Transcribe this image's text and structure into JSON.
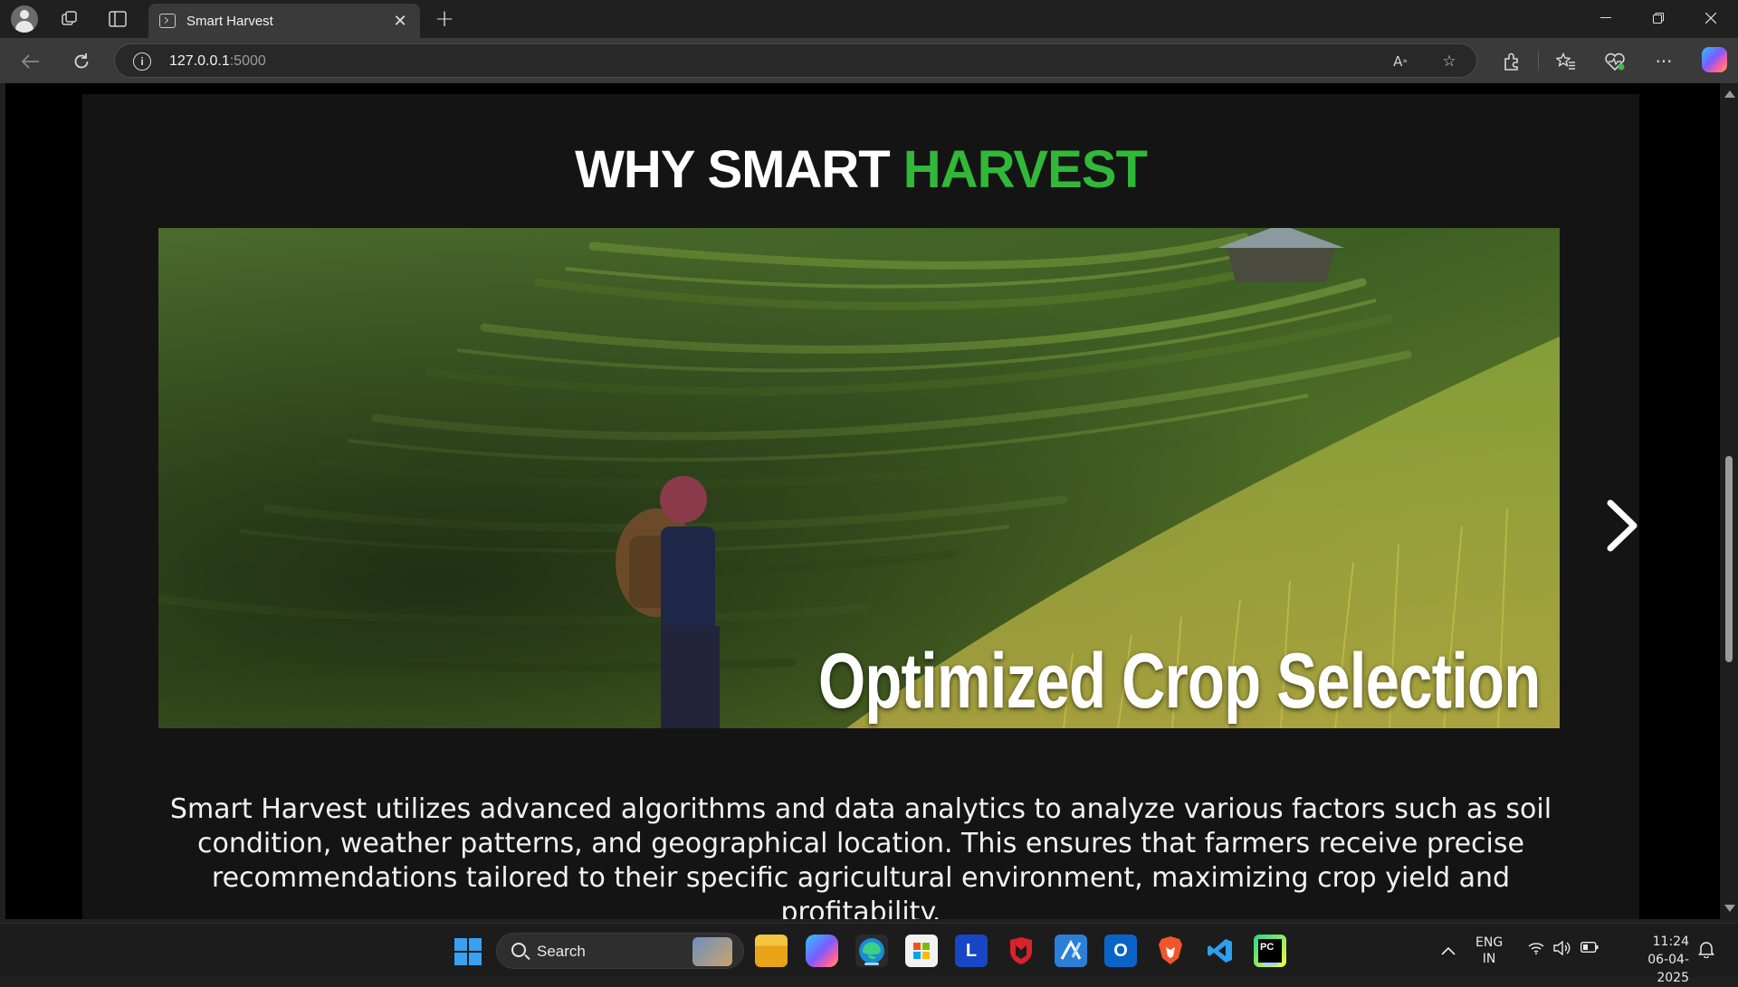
{
  "browser": {
    "tab_title": "Smart Harvest",
    "url_host": "127.0.0.1",
    "url_port": ":5000",
    "new_tab_symbol": "+",
    "close_symbol": "✕"
  },
  "page": {
    "heading_part1": "WHY SMART ",
    "heading_part2": "HARVEST",
    "heading_accent_color": "#31b838",
    "slide_caption": "Optimized Crop Selection",
    "description": "Smart Harvest utilizes advanced algorithms and data analytics to analyze various factors such as soil condition, weather patterns, and geographical location. This ensures that farmers receive precise recommendations tailored to their specific agricultural environment, maximizing crop yield and profitability."
  },
  "taskbar": {
    "search_label": "Search",
    "lang_line1": "ENG",
    "lang_line2": "IN",
    "time": "11:24",
    "date": "06-04-2025",
    "apps": [
      "file-explorer",
      "copilot",
      "edge",
      "microsoft-store",
      "l-app",
      "mcafee",
      "editor",
      "outlook",
      "brave",
      "vscode",
      "pycharm"
    ]
  }
}
